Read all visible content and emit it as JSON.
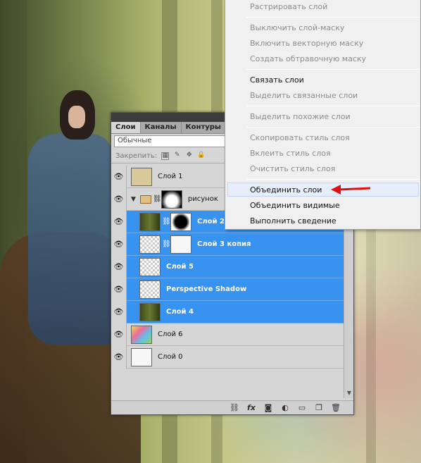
{
  "panel": {
    "tabs": [
      "Слои",
      "Каналы",
      "Контуры"
    ],
    "blend_mode": "Обычные",
    "lock_label": "Закрепить:",
    "layers": [
      {
        "name": "Слой 1",
        "selected": false,
        "thumb": "paper"
      },
      {
        "name": "рисунок",
        "selected": false,
        "thumb": "group"
      },
      {
        "name": "Слой 2",
        "selected": true,
        "thumb": "forest"
      },
      {
        "name": "Слой 3 копия",
        "selected": true,
        "thumb": "checker"
      },
      {
        "name": "Слой 5",
        "selected": true,
        "thumb": "checker"
      },
      {
        "name": "Perspective Shadow",
        "selected": true,
        "thumb": "checker"
      },
      {
        "name": "Слой 4",
        "selected": true,
        "thumb": "forest"
      },
      {
        "name": "Слой 6",
        "selected": false,
        "thumb": "colorful"
      },
      {
        "name": "Слой 0",
        "selected": false,
        "thumb": "white"
      }
    ],
    "footer_icons": [
      "link-icon",
      "fx-icon",
      "mask-icon",
      "adjustment-icon",
      "folder-icon",
      "new-layer-icon",
      "trash-icon"
    ]
  },
  "menu": {
    "items": [
      {
        "label": "Растрировать слой",
        "enabled": false
      },
      {
        "label": "Выключить слой-маску",
        "enabled": false
      },
      {
        "label": "Включить векторную маску",
        "enabled": false
      },
      {
        "label": "Создать обтравочную маску",
        "enabled": false
      },
      {
        "label": "Связать слои",
        "enabled": true
      },
      {
        "label": "Выделить связанные слои",
        "enabled": false
      },
      {
        "label": "Выделить похожие слои",
        "enabled": false
      },
      {
        "label": "Скопировать стиль слоя",
        "enabled": false
      },
      {
        "label": "Вклеить стиль слоя",
        "enabled": false
      },
      {
        "label": "Очистить стиль слоя",
        "enabled": false
      },
      {
        "label": "Объединить слои",
        "enabled": true,
        "highlighted": true
      },
      {
        "label": "Объединить видимые",
        "enabled": true
      },
      {
        "label": "Выполнить сведение",
        "enabled": true
      }
    ]
  },
  "colors": {
    "selection": "#3892f0",
    "annotation_arrow": "#e01010"
  }
}
